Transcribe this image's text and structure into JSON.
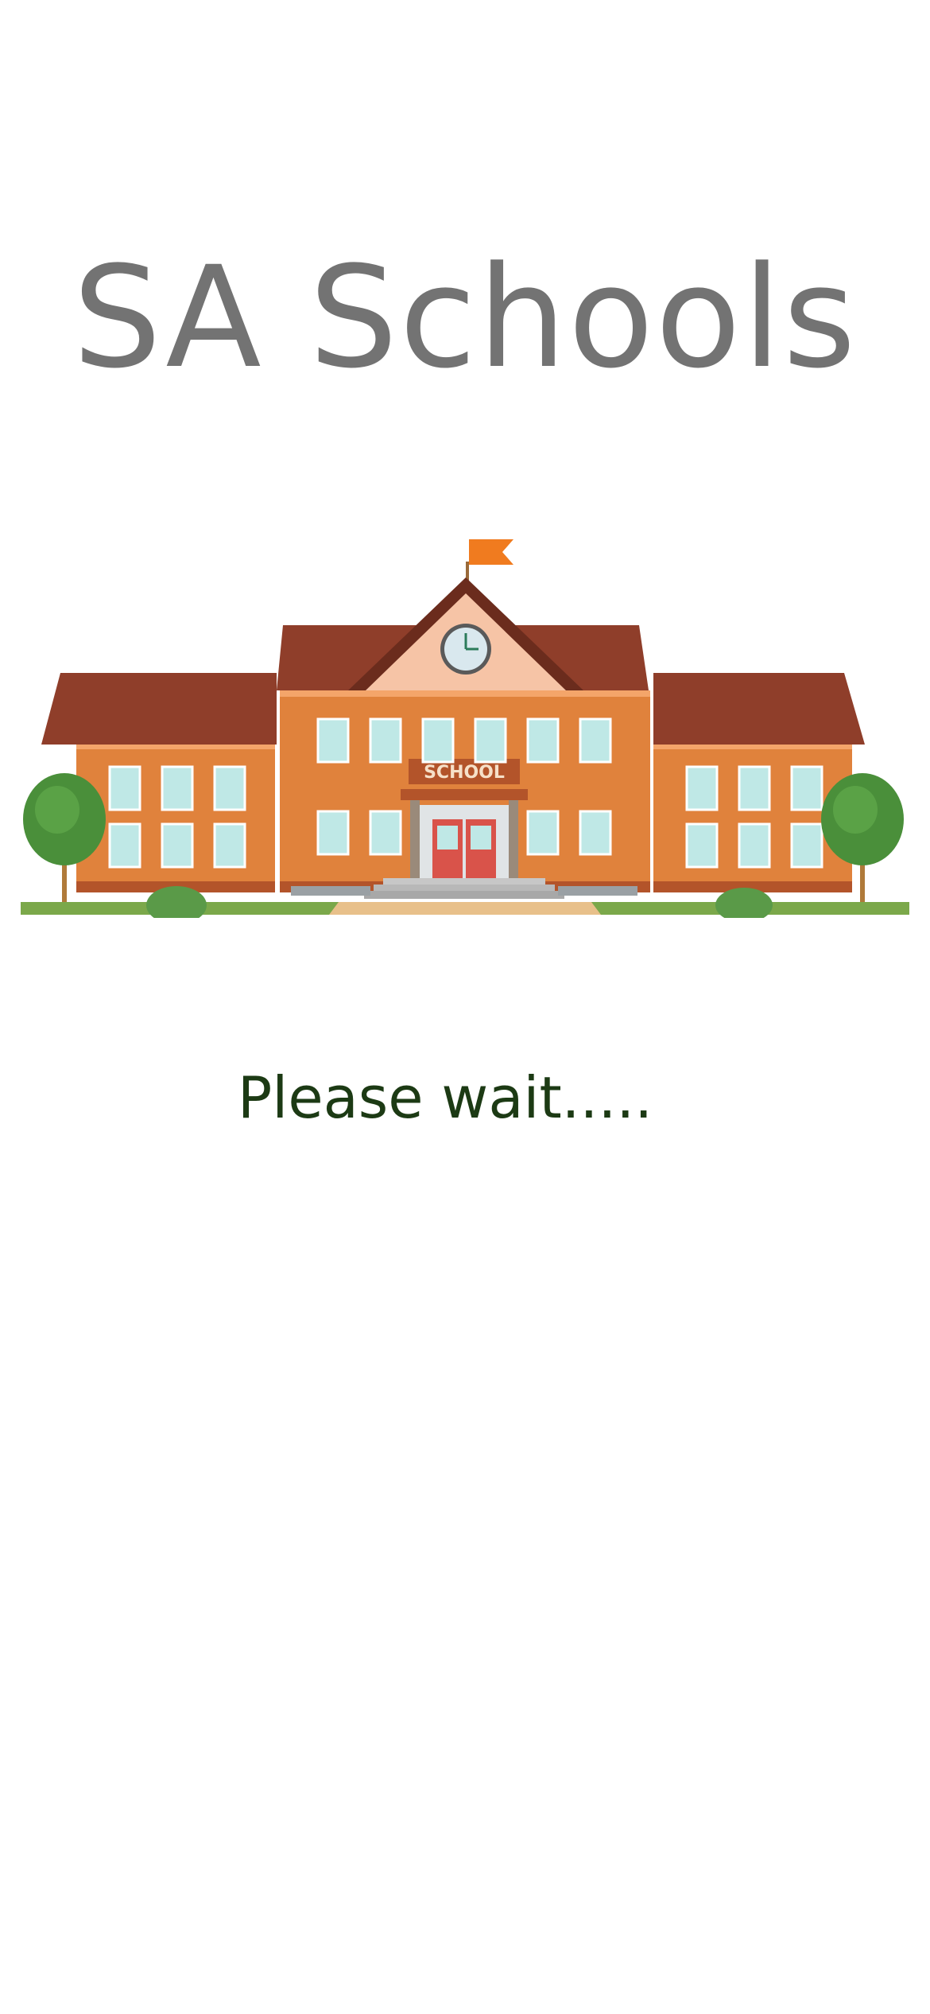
{
  "splash": {
    "title": "SA Schools",
    "illustration_icon": "school-building-icon",
    "sign_text": "SCHOOL",
    "status": "Please wait....."
  },
  "colors": {
    "background": "#ffffff",
    "title": "#737373",
    "status": "#1c3a14",
    "wall": "#e0823c",
    "roof": "#8f3e2a",
    "flag": "#f07b1f",
    "tree": "#4a8f3a"
  }
}
